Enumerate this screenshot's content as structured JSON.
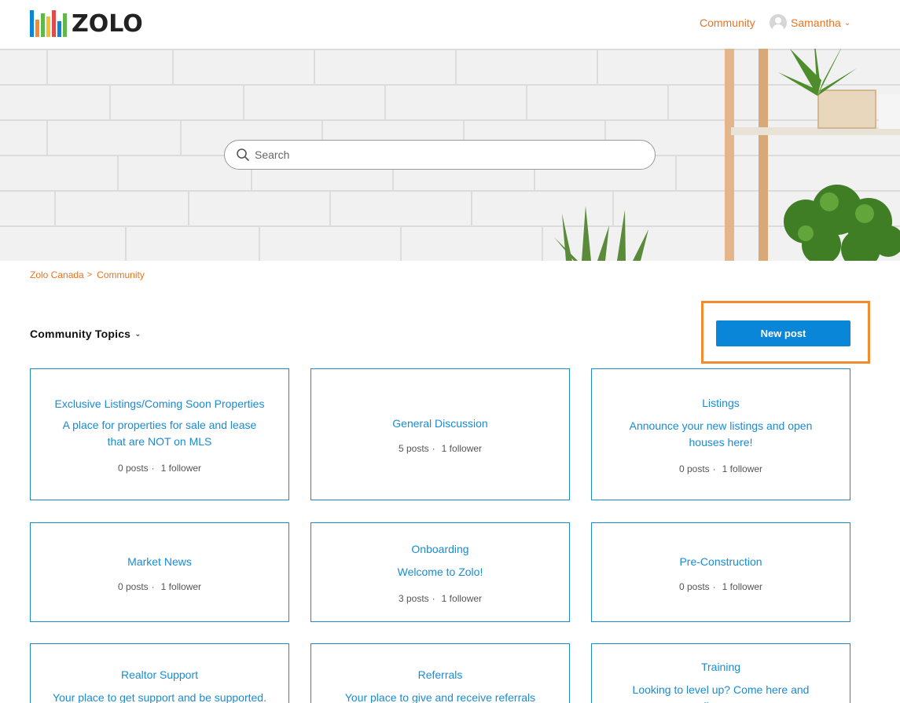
{
  "header": {
    "logo_text": "ZOLO",
    "logo_colors": [
      "#0a86d8",
      "#f28b30",
      "#5db94a",
      "#f2c12e",
      "#e24b4b",
      "#0a86d8",
      "#5db94a"
    ],
    "nav_community": "Community",
    "user_name": "Samantha"
  },
  "hero": {
    "search_placeholder": "Search"
  },
  "breadcrumb": {
    "items": [
      "Zolo Canada",
      "Community"
    ],
    "separator": ">"
  },
  "topics": {
    "title": "Community Topics",
    "new_post_label": "New post"
  },
  "cards": [
    {
      "title": "Exclusive Listings/Coming Soon Properties",
      "description": "A place for properties for sale and lease that are NOT on MLS",
      "posts": "0 posts",
      "followers": "1 follower"
    },
    {
      "title": "General Discussion",
      "description": "",
      "posts": "5 posts",
      "followers": "1 follower"
    },
    {
      "title": "Listings",
      "description": "Announce your new listings and open houses here!",
      "posts": "0 posts",
      "followers": "1 follower"
    },
    {
      "title": "Market News",
      "description": "",
      "posts": "0 posts",
      "followers": "1 follower"
    },
    {
      "title": "Onboarding",
      "description": "Welcome to Zolo!",
      "posts": "3 posts",
      "followers": "1 follower"
    },
    {
      "title": "Pre-Construction",
      "description": "",
      "posts": "0 posts",
      "followers": "1 follower"
    },
    {
      "title": "Realtor Support",
      "description": "Your place to get support and be supported.",
      "posts": "",
      "followers": ""
    },
    {
      "title": "Referrals",
      "description": "Your place to give and receive referrals",
      "posts": "",
      "followers": ""
    },
    {
      "title": "Training",
      "description": "Looking to level up? Come here and discover",
      "posts": "",
      "followers": ""
    }
  ],
  "colors": {
    "accent_orange": "#e8731f",
    "link_blue": "#1a8bd3",
    "button_blue": "#0a86d8",
    "highlight_orange": "#f28b30"
  }
}
